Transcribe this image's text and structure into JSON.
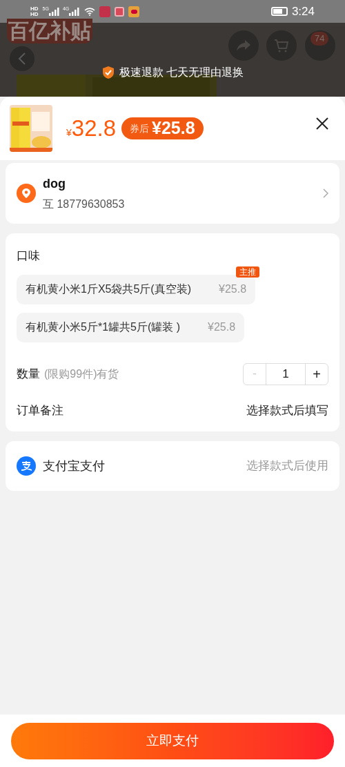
{
  "status_bar": {
    "network": [
      "HD",
      "HD"
    ],
    "signal_1": "5G",
    "signal_2": "4G",
    "time": "3:24"
  },
  "background_page": {
    "logo": "百亿补贴",
    "cart_badge": "74",
    "banner": "极速退款 七天无理由退换"
  },
  "product": {
    "price_symbol": "¥",
    "price": "32.8",
    "coupon_label": "券后",
    "coupon_price": "¥25.8"
  },
  "address": {
    "name": "dog",
    "phone": "互 18779630853"
  },
  "flavor": {
    "title": "口味",
    "options": [
      {
        "label": "有机黄小米1斤X5袋共5斤(真空装)",
        "price": "¥25.8",
        "badge": "主推",
        "selected": false
      },
      {
        "label": "有机黄小米5斤*1罐共5斤(罐装 )",
        "price": "¥25.8",
        "selected": false
      }
    ]
  },
  "quantity": {
    "label": "数量",
    "note": "(限购99件)有货",
    "minus": "-",
    "value": "1",
    "plus": "+",
    "minus_disabled": true
  },
  "remark": {
    "label": "订单备注",
    "value": "选择款式后填写"
  },
  "payment": {
    "label": "支付宝支付",
    "hint": "选择款式后使用"
  },
  "pay_button": "立即支付"
}
